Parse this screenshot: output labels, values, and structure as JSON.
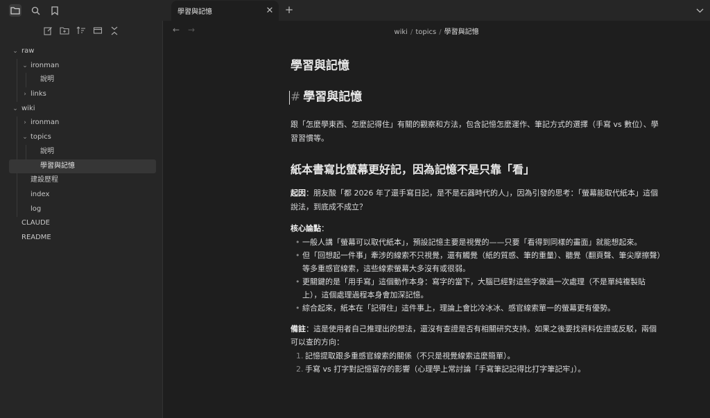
{
  "tab": {
    "title": "學習與記憶"
  },
  "sidebar": {
    "tree": [
      {
        "label": "raw",
        "depth": 0,
        "type": "folder",
        "open": true
      },
      {
        "label": "ironman",
        "depth": 1,
        "type": "folder",
        "open": true
      },
      {
        "label": "說明",
        "depth": 2,
        "type": "file"
      },
      {
        "label": "links",
        "depth": 1,
        "type": "folder",
        "open": false
      },
      {
        "label": "wiki",
        "depth": 0,
        "type": "folder",
        "open": true
      },
      {
        "label": "ironman",
        "depth": 1,
        "type": "folder",
        "open": false
      },
      {
        "label": "topics",
        "depth": 1,
        "type": "folder",
        "open": true
      },
      {
        "label": "說明",
        "depth": 2,
        "type": "file"
      },
      {
        "label": "學習與記憶",
        "depth": 2,
        "type": "file",
        "selected": true
      },
      {
        "label": "建設歷程",
        "depth": 1,
        "type": "file"
      },
      {
        "label": "index",
        "depth": 1,
        "type": "file"
      },
      {
        "label": "log",
        "depth": 1,
        "type": "file"
      },
      {
        "label": "CLAUDE",
        "depth": 0,
        "type": "file"
      },
      {
        "label": "README",
        "depth": 0,
        "type": "file"
      }
    ]
  },
  "breadcrumb": {
    "part1": "wiki",
    "part2": "topics",
    "current": "學習與記憶"
  },
  "note": {
    "inline_title": "學習與記憶",
    "h1_hash": "#",
    "h1": "學習與記憶",
    "intro": "跟「怎麼學東西、怎麼記得住」有關的觀察和方法，包含記憶怎麼運作、筆記方式的選擇（手寫 vs 數位）、學習習慣等。",
    "h2": "紙本書寫比螢幕更好記，因為記憶不是只靠「看」",
    "cause_label": "起因",
    "cause_text": "：朋友酸「都 2026 年了還手寫日記，是不是石器時代的人」，因為引發的思考：「螢幕能取代紙本」這個說法，到底成不成立？",
    "core_label": "核心論點",
    "core_colon": "：",
    "bullets": [
      "一般人講「螢幕可以取代紙本」，預設記憶主要是視覺的——只要「看得到同樣的畫面」就能想起來。",
      "但「回想起一件事」牽涉的線索不只視覺，還有觸覺（紙的質感、筆的重量）、聽覺（翻頁聲、筆尖摩擦聲）等多重感官線索，這些線索螢幕大多沒有或很弱。",
      "更關鍵的是「用手寫」這個動作本身：寫字的當下，大腦已經對這些字做過一次處理（不是單純複製貼上），這個處理過程本身會加深記憶。",
      "綜合起來，紙本在「記得住」這件事上，理論上會比冷冰冰、感官線索單一的螢幕更有優勢。"
    ],
    "remark_label": "備註",
    "remark_text": "：這是使用者自己推理出的想法，還沒有查證是否有相關研究支持。如果之後要找資料佐證或反駁，兩個可以查的方向：",
    "numbered": [
      "記憶提取跟多重感官線索的關係（不只是視覺線索這麼簡單）。",
      "手寫 vs 打字對記憶留存的影響（心理學上常討論「手寫筆記記得比打字筆記牢」）。"
    ]
  }
}
